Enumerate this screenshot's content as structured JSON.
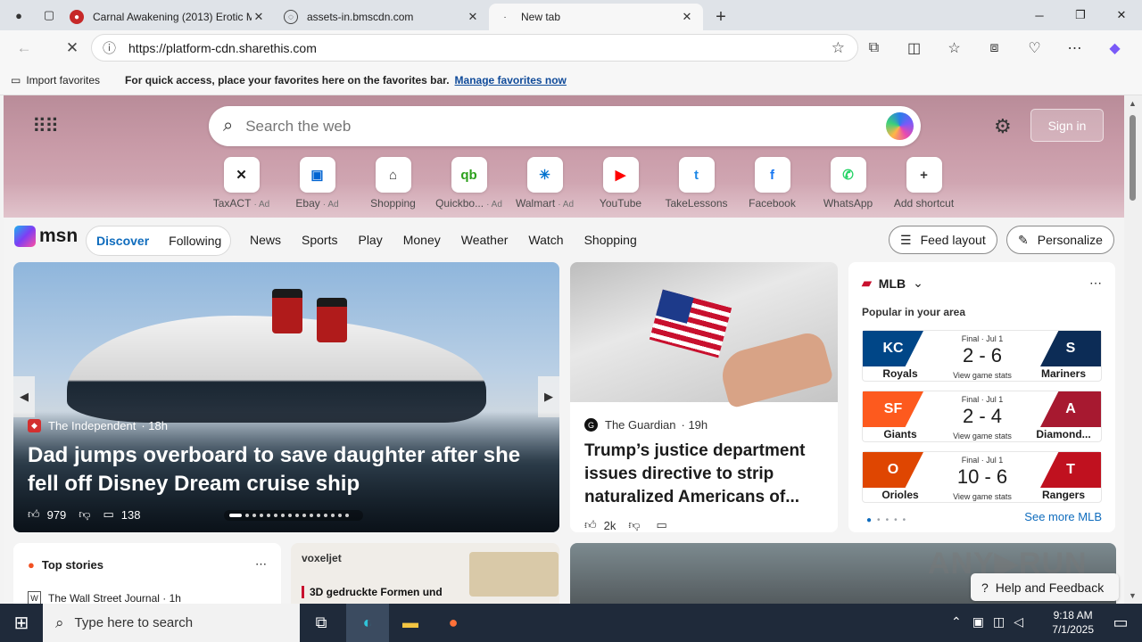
{
  "browser": {
    "tabs": [
      {
        "title": "Carnal Awakening (2013) Erotic M",
        "active": false
      },
      {
        "title": "assets-in.bmscdn.com",
        "active": false
      },
      {
        "title": "New tab",
        "active": true
      }
    ],
    "url": "https://platform-cdn.sharethis.com",
    "favbar": {
      "import": "Import favorites",
      "hint": "For quick access, place your favorites here on the favorites bar.",
      "manage": "Manage favorites now"
    }
  },
  "newtab": {
    "search_placeholder": "Search the web",
    "signin": "Sign in",
    "shortcuts": [
      {
        "label": "TaxACT",
        "ad": "· Ad",
        "icon": "taxact-icon",
        "color": "#1b1b1b",
        "glyph": "✕"
      },
      {
        "label": "Ebay",
        "ad": "· Ad",
        "icon": "ebay-icon",
        "color": "#0064d2",
        "glyph": "▣"
      },
      {
        "label": "Shopping",
        "ad": "",
        "icon": "shopping-tag-icon",
        "color": "#333333",
        "glyph": "⌂"
      },
      {
        "label": "Quickbo...",
        "ad": "· Ad",
        "icon": "quickbooks-icon",
        "color": "#2ca01c",
        "glyph": "qb"
      },
      {
        "label": "Walmart",
        "ad": "· Ad",
        "icon": "walmart-icon",
        "color": "#0071ce",
        "glyph": "✳"
      },
      {
        "label": "YouTube",
        "ad": "",
        "icon": "youtube-icon",
        "color": "#ff0000",
        "glyph": "▶"
      },
      {
        "label": "TakeLessons",
        "ad": "",
        "icon": "takelessons-icon",
        "color": "#1e88e5",
        "glyph": "t"
      },
      {
        "label": "Facebook",
        "ad": "",
        "icon": "facebook-icon",
        "color": "#1877f2",
        "glyph": "f"
      },
      {
        "label": "WhatsApp",
        "ad": "",
        "icon": "whatsapp-icon",
        "color": "#25d366",
        "glyph": "✆"
      },
      {
        "label": "Add shortcut",
        "ad": "",
        "icon": "plus-icon",
        "color": "#333333",
        "glyph": "+"
      }
    ],
    "msn": {
      "logo": "msn",
      "tabs": [
        "Discover",
        "Following"
      ],
      "nav": [
        "News",
        "Sports",
        "Play",
        "Money",
        "Weather",
        "Watch",
        "Shopping"
      ],
      "feed_layout": "Feed layout",
      "personalize": "Personalize"
    }
  },
  "hero": {
    "source": "The Independent",
    "age": "· 18h",
    "title": "Dad jumps overboard to save daughter after she fell off Disney Dream cruise ship",
    "likes": "979",
    "comments": "138"
  },
  "guardian": {
    "source": "The Guardian",
    "age": "· 19h",
    "title": "Trump’s justice department issues directive to strip naturalized Americans of...",
    "likes": "2k"
  },
  "mlb": {
    "title": "MLB",
    "subtitle": "Popular in your area",
    "games": [
      {
        "status": "Final · Jul 1",
        "score": "2 - 6",
        "stats": "View game stats",
        "home": "Royals",
        "away": "Mariners",
        "homeColor": "#004687",
        "awayColor": "#0c2c56",
        "homeGlyph": "KC",
        "awayGlyph": "S"
      },
      {
        "status": "Final · Jul 1",
        "score": "2 - 4",
        "stats": "View game stats",
        "home": "Giants",
        "away": "Diamond...",
        "homeColor": "#fd5a1e",
        "awayColor": "#a71930",
        "homeGlyph": "SF",
        "awayGlyph": "A"
      },
      {
        "status": "Final · Jul 1",
        "score": "10 - 6",
        "stats": "View game stats",
        "home": "Orioles",
        "away": "Rangers",
        "homeColor": "#df4601",
        "awayColor": "#c0111f",
        "homeGlyph": "O",
        "awayGlyph": "T"
      }
    ],
    "see_more": "See more MLB"
  },
  "top_stories": {
    "title": "Top stories",
    "first_source": "The Wall Street Journal · 1h"
  },
  "ad": {
    "brand": "voxeljet",
    "headline": "3D gedruckte Formen und"
  },
  "help": "Help and Feedback",
  "taskbar": {
    "search": "Type here to search",
    "time": "9:18 AM",
    "date": "7/1/2025"
  }
}
